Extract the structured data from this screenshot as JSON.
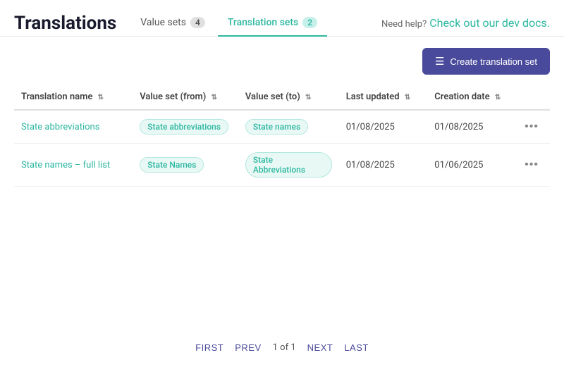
{
  "page": {
    "title": "Translations",
    "help_text": "Need help?",
    "help_link_text": "Check out our dev docs.",
    "help_link_url": "#"
  },
  "tabs": [
    {
      "id": "value-sets",
      "label": "Value sets",
      "count": "4",
      "active": false
    },
    {
      "id": "translation-sets",
      "label": "Translation sets",
      "count": "2",
      "active": true
    }
  ],
  "toolbar": {
    "create_button_label": "Create translation set",
    "create_icon": "≡+"
  },
  "table": {
    "columns": [
      {
        "id": "name",
        "label": "Translation name"
      },
      {
        "id": "from",
        "label": "Value set (from)"
      },
      {
        "id": "to",
        "label": "Value set (to)"
      },
      {
        "id": "updated",
        "label": "Last updated"
      },
      {
        "id": "created",
        "label": "Creation date"
      }
    ],
    "rows": [
      {
        "name": "State abbreviations",
        "value_set_from": "State abbreviations",
        "value_set_to": "State names",
        "last_updated": "01/08/2025",
        "creation_date": "01/08/2025"
      },
      {
        "name": "State names – full list",
        "value_set_from": "State Names",
        "value_set_to": "State Abbreviations",
        "last_updated": "01/08/2025",
        "creation_date": "01/06/2025"
      }
    ]
  },
  "pagination": {
    "first": "FIRST",
    "prev": "PREV",
    "info": "1 of 1",
    "next": "NEXT",
    "last": "LAST"
  }
}
